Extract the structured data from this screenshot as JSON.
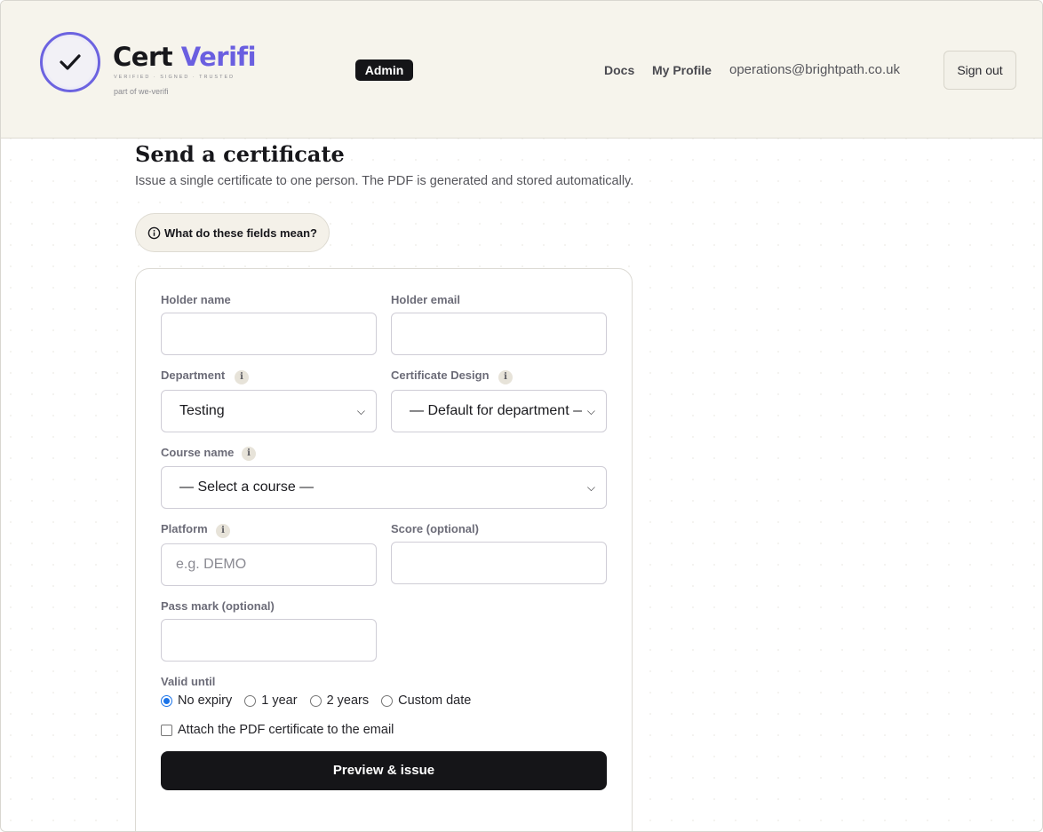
{
  "header": {
    "brand_part1": "Cert",
    "brand_part2": "Verifi",
    "tagline": "VERIFIED · SIGNED · TRUSTED",
    "part_of": "part of we-verifi",
    "badge": "Admin",
    "nav": {
      "docs": "Docs",
      "profile": "My Profile"
    },
    "user_email": "operations@brightpath.co.uk",
    "sign_out": "Sign out"
  },
  "page": {
    "title": "Send a certificate",
    "subtitle": "Issue a single certificate to one person. The PDF is generated and stored automatically.",
    "help_label": "What do these fields mean?"
  },
  "form": {
    "holder_name": {
      "label": "Holder name",
      "value": ""
    },
    "holder_email": {
      "label": "Holder email",
      "value": ""
    },
    "department": {
      "label": "Department",
      "selected": "Testing"
    },
    "design": {
      "label": "Certificate Design",
      "selected": "— Default for department —"
    },
    "course": {
      "label": "Course name",
      "selected": "— Select a course —"
    },
    "platform": {
      "label": "Platform",
      "placeholder": "e.g. DEMO"
    },
    "score": {
      "label": "Score (optional)",
      "value": ""
    },
    "pass_mark": {
      "label": "Pass mark (optional)",
      "value": ""
    },
    "valid_until": {
      "label": "Valid until",
      "options": [
        "No expiry",
        "1 year",
        "2 years",
        "Custom date"
      ],
      "selected": "No expiry"
    },
    "attach_pdf": {
      "label": "Attach the PDF certificate to the email",
      "checked": false
    },
    "submit": "Preview & issue"
  },
  "colors": {
    "accent": "#6a5fe0",
    "header_bg": "#f6f4ec",
    "dark": "#151518"
  }
}
